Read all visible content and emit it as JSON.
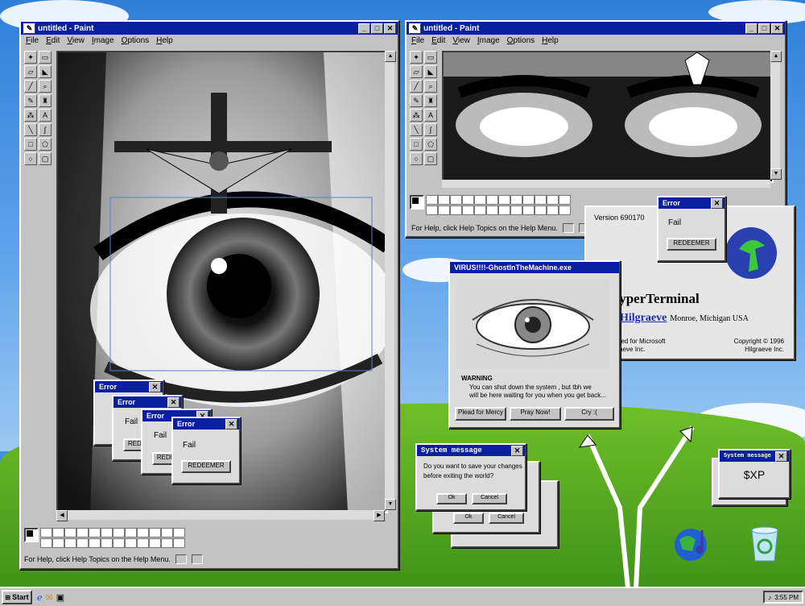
{
  "paint_left": {
    "title": "untitled - Paint",
    "menus": [
      "File",
      "Edit",
      "View",
      "Image",
      "Options",
      "Help"
    ],
    "status_text": "For Help, click Help Topics on the Help Menu."
  },
  "paint_right": {
    "title": "untitled - Paint",
    "menus": [
      "File",
      "Edit",
      "View",
      "Image",
      "Options",
      "Help"
    ],
    "status_text": "For Help, click Help Topics on the Help Menu."
  },
  "error_dialogs": {
    "title": "Error",
    "message": "Fail",
    "button": "REDEEMER",
    "button_partial": "REDE"
  },
  "about_hyperterminal": {
    "version": "Version 690170",
    "product": "HyperTerminal",
    "by": "by",
    "company": "Hilgraeve",
    "location": "Monroe, Michigan  USA",
    "developed_1": "Developed for Microsoft",
    "developed_2": "by Hilgraeve Inc.",
    "copyright_1": "Copyright © 1996",
    "copyright_2": "Hilgraeve Inc."
  },
  "virus_window": {
    "title": "VIRUS!!!!-GhostInTheMachine.exe",
    "warning_label": "WARNING",
    "warning_line1": "You can shut down the system , but tbh we",
    "warning_line2": "will be here waiting for you when you get back...",
    "buttons": [
      "Plead for Mercy",
      "Pray Now!",
      "Cry :("
    ]
  },
  "system_message": {
    "title": "System message",
    "line1": "Do you want to save your changes",
    "line2": "before exiting the world?",
    "ok": "Ok",
    "cancel": "Cancel"
  },
  "xp_message": {
    "title": "System message",
    "text": "$XP"
  },
  "taskbar": {
    "start": "Start",
    "clock": "3:55 PM"
  },
  "colors": {
    "titlebar": "#0a1fa0",
    "window_face": "#c3c3c3",
    "desktop_sky": "#3f8fe0",
    "hill": "#4aa020"
  }
}
